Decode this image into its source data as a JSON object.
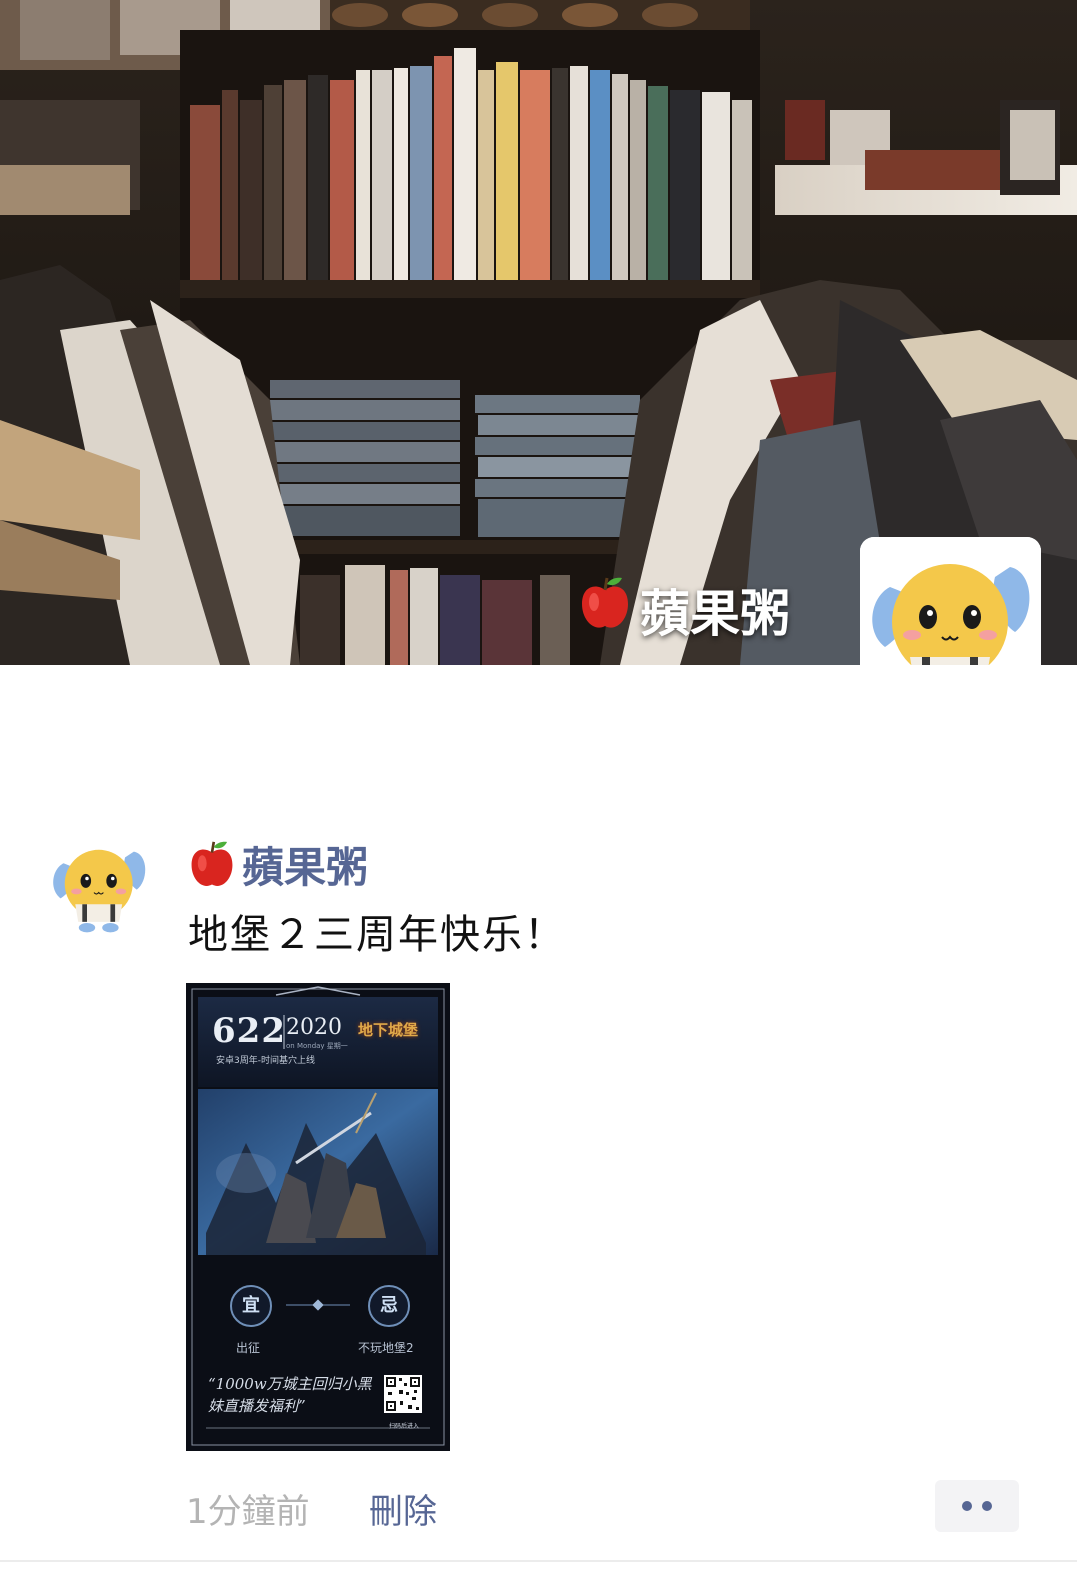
{
  "profile": {
    "display_name": "蘋果粥",
    "name_emoji": "apple-icon"
  },
  "post": {
    "author": "蘋果粥",
    "text": "地堡２三周年快乐！",
    "time": "1分鐘前",
    "delete_label": "刪除",
    "image": {
      "date": "622",
      "year": "2020",
      "weekday": "on Monday 星期一",
      "game_logo": "地下城堡",
      "subtitle": "安卓3周年-时间基穴上线",
      "good_label": "宜",
      "bad_label": "忌",
      "good_item": "出征",
      "bad_item": "不玩地堡2",
      "quote": "“1000w万城主回归小黑妹直播发福利”",
      "qr_caption": "扫码后进入"
    }
  },
  "colors": {
    "link": "#566694",
    "time": "#b4b4b4",
    "text": "#111111"
  }
}
